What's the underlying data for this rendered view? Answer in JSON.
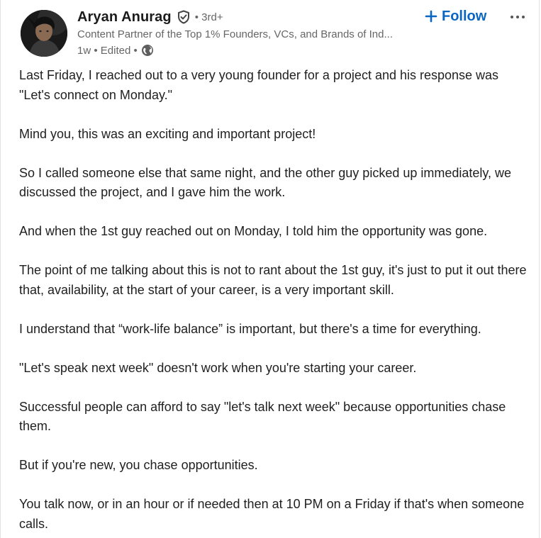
{
  "author": {
    "name": "Aryan Anurag",
    "degree": "• 3rd+",
    "headline": "Content Partner of the Top 1% Founders, VCs, and Brands of Ind...",
    "meta": "1w • Edited •",
    "avatar_icon": "avatar-photo",
    "verified_icon": "verified-shield-icon",
    "visibility_icon": "globe-icon"
  },
  "actions": {
    "follow_label": "Follow",
    "follow_icon": "plus-icon",
    "more_icon": "ellipsis-icon"
  },
  "colors": {
    "accent": "#0a66c2",
    "secondary_text": "#666666",
    "body_text": "#1f1f1f"
  },
  "post": {
    "paragraphs": [
      "Last Friday, I reached out to a very young founder for a project and his response was \"Let's connect on Monday.\"",
      "Mind you, this was an exciting and important project!",
      "So I called someone else that same night, and the other guy picked up immediately, we discussed the project, and I gave him the work.",
      "And when the 1st guy reached out on Monday, I told him the opportunity was gone.",
      "The point of me talking about this is not to rant about the 1st guy, it's just to put it out there that, availability, at the start of your career, is a very important skill.",
      "I understand that “work-life balance” is important, but there's a time for everything.",
      "\"Let's speak next week\" doesn't work when you're starting your career.",
      "Successful people can afford to say \"let's talk next week\" because opportunities chase them.",
      "But if you're new, you chase opportunities.",
      "You talk now, or in an hour or if needed then at 10 PM on a Friday if that's when someone calls."
    ]
  }
}
